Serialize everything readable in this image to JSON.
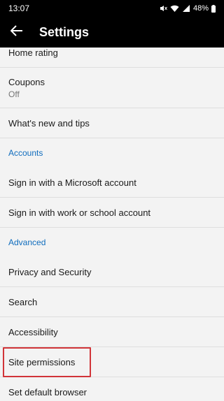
{
  "status": {
    "time": "13:07",
    "battery": "48%"
  },
  "header": {
    "title": "Settings"
  },
  "items_top": [
    {
      "label": "Home rating",
      "sub": ""
    },
    {
      "label": "Coupons",
      "sub": "Off"
    },
    {
      "label": "What's new and tips",
      "sub": ""
    }
  ],
  "sections": {
    "accounts": "Accounts",
    "advanced": "Advanced"
  },
  "accounts_items": [
    {
      "label": "Sign in with a Microsoft account"
    },
    {
      "label": "Sign in with work or school account"
    }
  ],
  "advanced_items": [
    {
      "label": "Privacy and Security"
    },
    {
      "label": "Search"
    },
    {
      "label": "Accessibility"
    },
    {
      "label": "Site permissions"
    },
    {
      "label": "Set default browser"
    }
  ],
  "colors": {
    "accent": "#0f6cbd",
    "highlight": "#d13438"
  }
}
